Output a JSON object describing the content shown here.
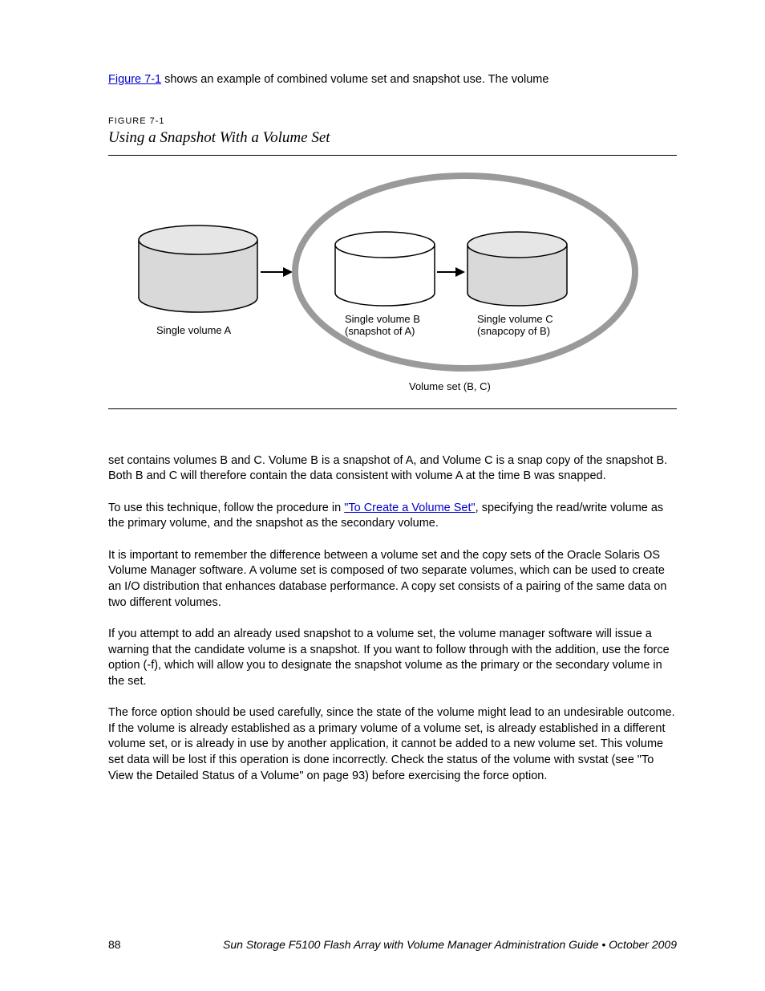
{
  "intro": {
    "link_text": "Figure 7-1",
    "after_link": " shows an example of combined volume set and snapshot use.  The volume "
  },
  "figure": {
    "label": "FIGURE 7-1",
    "title": "Using a Snapshot With a Volume Set",
    "captions": {
      "a": "Single volume A",
      "b_line1": "Single volume B",
      "b_line2": "(snapshot of A)",
      "c_line1": "Single volume C",
      "c_line2": "(snapcopy of B)",
      "set": "Volume set (B, C)"
    }
  },
  "body": {
    "p1": "set contains volumes B and C. Volume B is a snapshot of A, and Volume C is a snap copy of the snapshot B. Both B and C will therefore contain the data consistent with volume A at the time B was snapped.",
    "p2_before": "To use this technique, follow the procedure in ",
    "p2_link": "\"To Create a Volume Set\"",
    "p2_after": ", specifying the read/write volume as the primary volume, and the snapshot as the secondary volume.",
    "p3": "It is important to remember the difference between a volume set and the copy sets of the Oracle Solaris OS Volume Manager software. A volume set is composed of two separate volumes, which can be used to create an I/O distribution that enhances database performance. A copy set consists of a pairing of the same data on two different volumes.",
    "p4": "If you attempt to add an already used snapshot to a volume set, the volume manager software will issue a warning that the candidate volume is a snapshot. If you want to follow through with the addition, use the force option (-f), which will allow you to designate the snapshot volume as the primary or the secondary volume in the set.",
    "p5": "The force option should be used carefully, since the state of the volume might lead to an undesirable outcome. If the volume is already established as a primary volume of a volume set, is already established in a different volume set, or is already in use by another application, it cannot be added to a new volume set. This volume set data will be lost if this operation is done incorrectly. Check the status of the volume with svstat (see \"To View the Detailed Status of a Volume\" on page 93) before exercising the force option."
  },
  "footer": {
    "left": "88",
    "right": "Sun Storage F5100 Flash Array with Volume Manager Administration Guide • October 2009"
  }
}
